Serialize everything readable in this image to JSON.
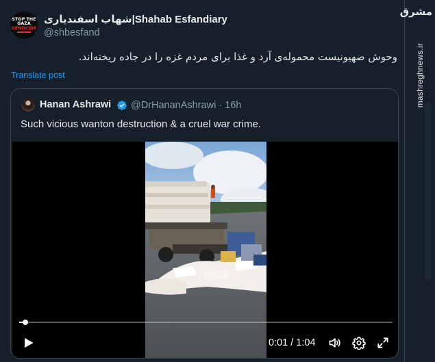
{
  "tweet": {
    "author": {
      "display_name": "شهاب اسفندیاری|Shahab Esfandiary",
      "handle": "@shbesfand",
      "avatar_lines": [
        "STOP THE",
        "GAZA",
        "GENOCIDE"
      ]
    },
    "text": "وحوش صهیونیست محموله‌ی آرد و غذا برای مردم غزه را در جاده ریخته‌اند.",
    "translate_label": "Translate post"
  },
  "quote": {
    "author": {
      "display_name": "Hanan Ashrawi",
      "handle_time": "@DrHananAshrawi · 16h"
    },
    "text": "Such vicious wanton destruction & a cruel war crime.",
    "video": {
      "current_time": "0:01",
      "duration": "1:04",
      "time_display": "0:01 / 1:04",
      "progress_fraction": 0.016
    }
  },
  "watermark": {
    "logo": "مشرق",
    "site": "mashreghnews.ir"
  },
  "colors": {
    "background": "#15202b",
    "border": "#38444d",
    "accent": "#1d9bf0",
    "muted": "#8b98a5",
    "text": "#e7e9ea"
  },
  "icons": [
    "play-icon",
    "volume-icon",
    "settings-gear-icon",
    "fullscreen-icon",
    "verified-badge-icon"
  ]
}
